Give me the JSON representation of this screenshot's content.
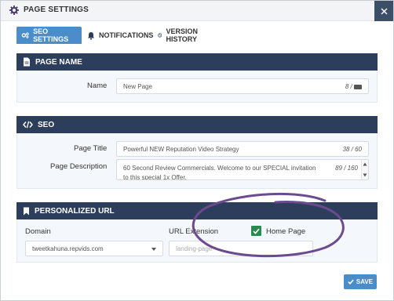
{
  "window": {
    "title": "PAGE SETTINGS",
    "close_icon": "close-icon"
  },
  "tabs": [
    {
      "label": "SEO SETTINGS",
      "icon": "gears-icon",
      "active": true
    },
    {
      "label": "NOTIFICATIONS",
      "icon": "bell-icon",
      "active": false
    },
    {
      "label": "VERSION HISTORY",
      "icon": "clock-icon",
      "active": false
    }
  ],
  "page_name": {
    "header": "PAGE NAME",
    "name_label": "Name",
    "name_value": "New Page",
    "name_counter": "8 / "
  },
  "seo": {
    "header": "SEO",
    "title_label": "Page Title",
    "title_value": "Powerful NEW Reputation Video Strategy",
    "title_counter": "38 / 60",
    "desc_label": "Page Description",
    "desc_value": "60 Second Review Commercials. Welcome to our SPECIAL invitation to this special 1x Offer.",
    "desc_counter": "89 / 160"
  },
  "personalized_url": {
    "header": "PERSONALIZED URL",
    "domain_label": "Domain",
    "domain_value": "tweetkahuna.repvids.com",
    "extension_label": "URL Extension",
    "extension_placeholder": "landing-page",
    "home_page_label": "Home Page",
    "home_page_checked": true
  },
  "footer": {
    "save_label": "SAVE"
  },
  "colors": {
    "header_bg": "#2c3e5c",
    "accent": "#4a8dc9",
    "checkbox": "#2a8a4e",
    "annotation": "#6b4a8f"
  }
}
